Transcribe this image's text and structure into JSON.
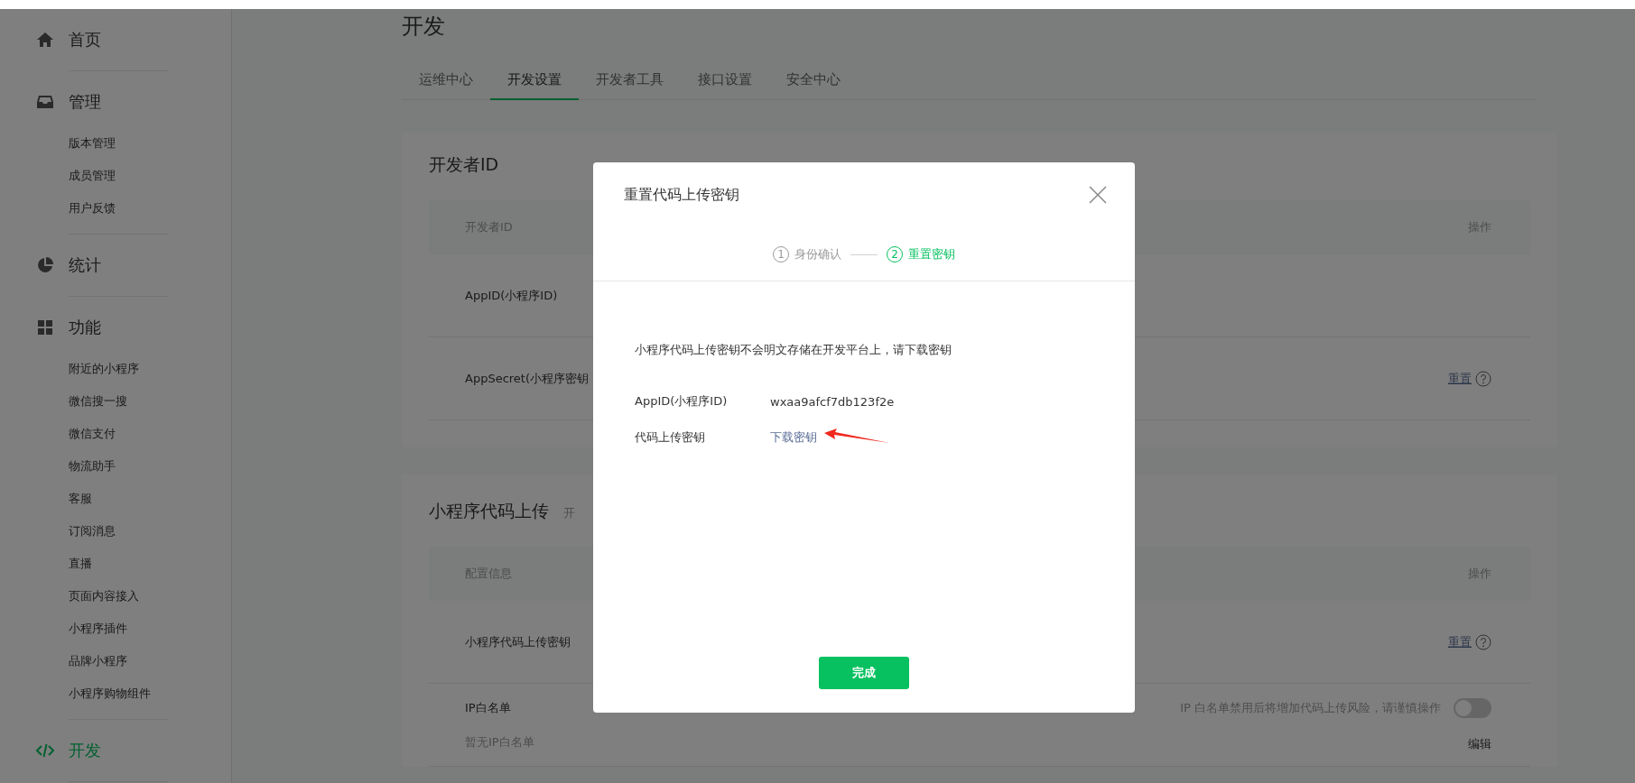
{
  "sidebar": {
    "sections": [
      {
        "kind": "home",
        "label": "首页",
        "selected": false
      },
      {
        "kind": "inbox",
        "label": "管理",
        "selected": false,
        "items": [
          {
            "label": "版本管理"
          },
          {
            "label": "成员管理"
          },
          {
            "label": "用户反馈"
          }
        ]
      },
      {
        "kind": "stats",
        "label": "统计",
        "selected": false
      },
      {
        "kind": "grid",
        "label": "功能",
        "selected": false,
        "items": [
          {
            "label": "附近的小程序"
          },
          {
            "label": "微信搜一搜"
          },
          {
            "label": "微信支付"
          },
          {
            "label": "物流助手"
          },
          {
            "label": "客服"
          },
          {
            "label": "订阅消息"
          },
          {
            "label": "直播"
          },
          {
            "label": "页面内容接入"
          },
          {
            "label": "小程序插件"
          },
          {
            "label": "品牌小程序"
          },
          {
            "label": "小程序购物组件"
          }
        ]
      },
      {
        "kind": "code",
        "label": "开发",
        "selected": true
      }
    ]
  },
  "page": {
    "title": "开发",
    "tabs": [
      {
        "label": "运维中心",
        "selected": false
      },
      {
        "label": "开发设置",
        "selected": true
      },
      {
        "label": "开发者工具",
        "selected": false
      },
      {
        "label": "接口设置",
        "selected": false
      },
      {
        "label": "安全中心",
        "selected": false
      }
    ],
    "cards": [
      {
        "title": "开发者ID",
        "columns": [
          "开发者ID",
          "操作"
        ],
        "rows": [
          {
            "kind": "plain",
            "label": "AppID(小程序ID)"
          },
          {
            "kind": "reset",
            "label": "AppSecret(小程序密钥",
            "action": "重置"
          }
        ]
      },
      {
        "title": "小程序代码上传",
        "subtitle": "开",
        "columns": [
          "配置信息",
          "操作"
        ],
        "rows": [
          {
            "kind": "reset",
            "label": "小程序代码上传密钥",
            "action": "重置"
          },
          {
            "kind": "whitelist",
            "label": "IP白名单",
            "note": "暂无IP白名单",
            "warning": "IP 白名单禁用后将增加代码上传风险，请谨慎操作",
            "on": false,
            "action": "编辑"
          }
        ]
      }
    ]
  },
  "dialog": {
    "title": "重置代码上传密钥",
    "steps": [
      {
        "number": "1",
        "label": "身份确认",
        "selected": false
      },
      {
        "number": "2",
        "label": "重置密钥",
        "selected": true
      }
    ],
    "message": "小程序代码上传密钥不会明文存储在开发平台上，请下载密钥",
    "fields": [
      {
        "label": "AppID(小程序ID)",
        "kind": "text",
        "value": "wxaa9afcf7db123f2e"
      },
      {
        "label": "代码上传密钥",
        "kind": "link",
        "value": "下载密钥"
      }
    ],
    "button": "完成"
  }
}
